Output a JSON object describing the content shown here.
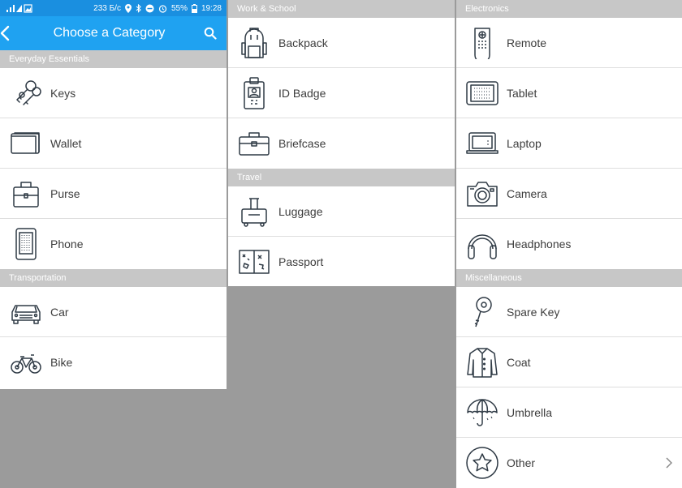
{
  "status_bar": {
    "speed": "233 Б/с",
    "battery": "55%",
    "time": "19:28"
  },
  "app_bar": {
    "title": "Choose a Category"
  },
  "columns": [
    {
      "sections": [
        {
          "title": "Everyday Essentials",
          "items": [
            {
              "label": "Keys",
              "icon": "keys-icon"
            },
            {
              "label": "Wallet",
              "icon": "wallet-icon"
            },
            {
              "label": "Purse",
              "icon": "purse-icon"
            },
            {
              "label": "Phone",
              "icon": "phone-icon"
            }
          ]
        },
        {
          "title": "Transportation",
          "items": [
            {
              "label": "Car",
              "icon": "car-icon"
            },
            {
              "label": "Bike",
              "icon": "bike-icon"
            }
          ]
        }
      ]
    },
    {
      "sections": [
        {
          "title": "Work & School",
          "items": [
            {
              "label": "Backpack",
              "icon": "backpack-icon"
            },
            {
              "label": "ID Badge",
              "icon": "id-badge-icon"
            },
            {
              "label": "Briefcase",
              "icon": "briefcase-icon"
            }
          ]
        },
        {
          "title": "Travel",
          "items": [
            {
              "label": "Luggage",
              "icon": "luggage-icon"
            },
            {
              "label": "Passport",
              "icon": "passport-icon"
            }
          ]
        }
      ]
    },
    {
      "sections": [
        {
          "title": "Electronics",
          "items": [
            {
              "label": "Remote",
              "icon": "remote-icon"
            },
            {
              "label": "Tablet",
              "icon": "tablet-icon"
            },
            {
              "label": "Laptop",
              "icon": "laptop-icon"
            },
            {
              "label": "Camera",
              "icon": "camera-icon"
            },
            {
              "label": "Headphones",
              "icon": "headphones-icon"
            }
          ]
        },
        {
          "title": "Miscellaneous",
          "items": [
            {
              "label": "Spare Key",
              "icon": "spare-key-icon"
            },
            {
              "label": "Coat",
              "icon": "coat-icon"
            },
            {
              "label": "Umbrella",
              "icon": "umbrella-icon"
            },
            {
              "label": "Other",
              "icon": "star-icon"
            }
          ]
        }
      ]
    }
  ],
  "colors": {
    "status_bar": "#1a8fe0",
    "app_bar": "#1fa2f1",
    "section_header": "#c7c7c7",
    "background": "#9b9b9b",
    "icon_stroke": "#2f3a45"
  }
}
